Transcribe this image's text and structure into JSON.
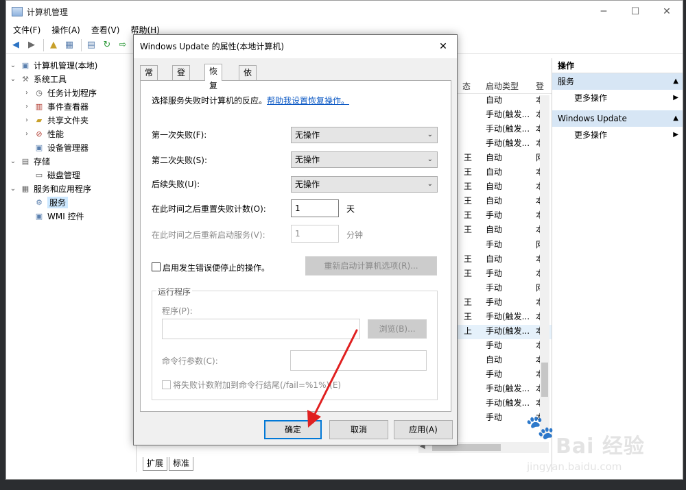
{
  "window": {
    "title": "计算机管理",
    "icon": "computer-management-icon"
  },
  "menu": [
    "文件(F)",
    "操作(A)",
    "查看(V)",
    "帮助(H)"
  ],
  "tree": {
    "items": [
      {
        "label": "计算机管理(本地)",
        "level": 0,
        "expanded": true,
        "icon": "computer-icon"
      },
      {
        "label": "系统工具",
        "level": 1,
        "expanded": true,
        "icon": "tools-icon"
      },
      {
        "label": "任务计划程序",
        "level": 2,
        "expanded": false,
        "icon": "clock-icon"
      },
      {
        "label": "事件查看器",
        "level": 2,
        "expanded": false,
        "icon": "event-viewer-icon"
      },
      {
        "label": "共享文件夹",
        "level": 2,
        "expanded": false,
        "icon": "shared-folder-icon"
      },
      {
        "label": "性能",
        "level": 2,
        "expanded": false,
        "icon": "performance-icon"
      },
      {
        "label": "设备管理器",
        "level": 2,
        "icon": "device-manager-icon"
      },
      {
        "label": "存储",
        "level": 1,
        "expanded": true,
        "icon": "storage-icon"
      },
      {
        "label": "磁盘管理",
        "level": 2,
        "icon": "disk-icon"
      },
      {
        "label": "服务和应用程序",
        "level": 1,
        "expanded": true,
        "icon": "services-apps-icon"
      },
      {
        "label": "服务",
        "level": 2,
        "selected": true,
        "icon": "services-icon"
      },
      {
        "label": "WMI 控件",
        "level": 2,
        "icon": "wmi-icon"
      }
    ]
  },
  "services": {
    "columns": [
      "态",
      "启动类型",
      "登"
    ],
    "rows": [
      {
        "c1": "",
        "c2": "自动",
        "c3": "本"
      },
      {
        "c1": "",
        "c2": "手动(触发...",
        "c3": "本"
      },
      {
        "c1": "",
        "c2": "手动(触发...",
        "c3": "本"
      },
      {
        "c1": "",
        "c2": "手动(触发...",
        "c3": "本"
      },
      {
        "c1": "王",
        "c2": "自动",
        "c3": "网"
      },
      {
        "c1": "王",
        "c2": "自动",
        "c3": "本"
      },
      {
        "c1": "王",
        "c2": "自动",
        "c3": "本"
      },
      {
        "c1": "王",
        "c2": "自动",
        "c3": "本"
      },
      {
        "c1": "王",
        "c2": "手动",
        "c3": "本"
      },
      {
        "c1": "王",
        "c2": "自动",
        "c3": "本"
      },
      {
        "c1": "",
        "c2": "手动",
        "c3": "网"
      },
      {
        "c1": "王",
        "c2": "自动",
        "c3": "本"
      },
      {
        "c1": "王",
        "c2": "手动",
        "c3": "本"
      },
      {
        "c1": "",
        "c2": "手动",
        "c3": "网"
      },
      {
        "c1": "王",
        "c2": "手动",
        "c3": "本"
      },
      {
        "c1": "王",
        "c2": "手动(触发...",
        "c3": "本"
      },
      {
        "c1": "上",
        "c2": "手动(触发...",
        "c3": "本",
        "selected": true
      },
      {
        "c1": "",
        "c2": "手动",
        "c3": "本"
      },
      {
        "c1": "",
        "c2": "自动",
        "c3": "本"
      },
      {
        "c1": "",
        "c2": "手动",
        "c3": "本"
      },
      {
        "c1": "",
        "c2": "手动(触发...",
        "c3": "本"
      },
      {
        "c1": "",
        "c2": "手动(触发...",
        "c3": "本"
      },
      {
        "c1": "",
        "c2": "手动",
        "c3": "本"
      }
    ]
  },
  "bottom_tabs": [
    "扩展",
    "标准"
  ],
  "actions": {
    "header": "操作",
    "groups": [
      {
        "title": "服务",
        "items": [
          "更多操作"
        ]
      },
      {
        "title": "Windows Update",
        "items": [
          "更多操作"
        ]
      }
    ]
  },
  "dialog": {
    "title": "Windows Update 的属性(本地计算机)",
    "tabs": [
      "常规",
      "登录",
      "恢复",
      "依存关系"
    ],
    "active_tab": "恢复",
    "description": "选择服务失败时计算机的反应。",
    "help_link": "帮助我设置恢复操作。",
    "first_failure": {
      "label": "第一次失败(F):",
      "value": "无操作"
    },
    "second_failure": {
      "label": "第二次失败(S):",
      "value": "无操作"
    },
    "subsequent_failure": {
      "label": "后续失败(U):",
      "value": "无操作"
    },
    "reset_count": {
      "label": "在此时间之后重置失败计数(O):",
      "value": "1",
      "unit": "天"
    },
    "restart_service": {
      "label": "在此时间之后重新启动服务(V):",
      "value": "1",
      "unit": "分钟"
    },
    "enable_stop_actions": {
      "label": "启用发生错误便停止的操作。",
      "checked": false
    },
    "restart_computer_button": "重新启动计算机选项(R)...",
    "run_program": {
      "group_title": "运行程序",
      "program_label": "程序(P):",
      "browse_button": "浏览(B)...",
      "cmdline_label": "命令行参数(C):",
      "append_label": "将失败计数附加到命令行结尾(/fail=%1%)(E)"
    },
    "buttons": {
      "ok": "确定",
      "cancel": "取消",
      "apply": "应用(A)"
    }
  },
  "watermark": {
    "brand": "Bai 经验",
    "url": "jingyan.baidu.com"
  },
  "colors": {
    "accent": "#0078d7",
    "arrow": "#e02020",
    "selection": "#cde8ff",
    "action_group": "#d7e6f5"
  }
}
